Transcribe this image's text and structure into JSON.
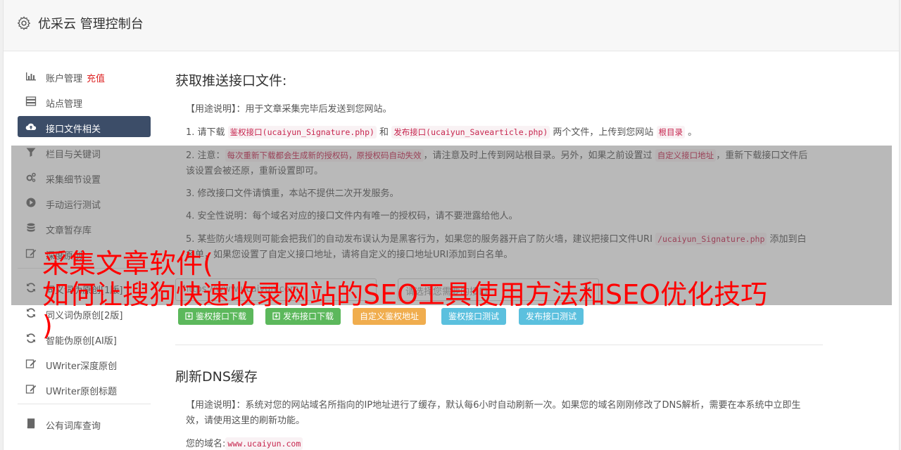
{
  "header": {
    "title": "优采云 管理控制台"
  },
  "sidebar": {
    "items": [
      {
        "label": "账户管理",
        "sub": "充值",
        "icon": "bar-chart-icon"
      },
      {
        "label": "站点管理",
        "icon": "server-icon"
      },
      {
        "label": "接口文件相关",
        "icon": "cloud-upload-icon",
        "active": true
      },
      {
        "label": "栏目与关键词",
        "icon": "filter-icon"
      },
      {
        "label": "采集细节设置",
        "icon": "cogs-icon"
      },
      {
        "label": "手动运行测试",
        "icon": "play-circle-icon"
      },
      {
        "label": "文章暂存库",
        "icon": "database-icon"
      },
      {
        "label": "深度原创",
        "icon": "edit-icon"
      }
    ],
    "items2": [
      {
        "label": "同义词伪原创[1版]",
        "icon": "refresh-icon"
      },
      {
        "label": "同义词伪原创[2版]",
        "icon": "refresh-icon"
      },
      {
        "label": "智能伪原创[AI版]",
        "icon": "refresh-icon"
      },
      {
        "label": "UWriter深度原创",
        "icon": "edit-icon"
      },
      {
        "label": "UWriter原创标题",
        "icon": "edit-icon"
      }
    ],
    "items3": [
      {
        "label": "公有词库查询",
        "icon": "book-icon"
      }
    ]
  },
  "section1": {
    "title": "获取推送接口文件:",
    "usage_label": "【用途说明】",
    "usage_text": "：用于文章采集完毕后发送到您网站。",
    "p1_a": "1. 请下载 ",
    "p1_code1": "鉴权接口(ucaiyun_Signature.php)",
    "p1_b": " 和 ",
    "p1_code2": "发布接口(ucaiyun_Savearticle.php)",
    "p1_c": " 两个文件，上传到您网站 ",
    "p1_code3": "根目录",
    "p1_d": " 。",
    "p2_a": "2. 注意：",
    "p2_code1": "每次重新下载都会生成新的授权码，原授权码自动失效",
    "p2_b": "，请注意及时上传到网站根目录。另外，如果之前设置过 ",
    "p2_code2": "自定义接口地址",
    "p2_c": "，重新下载接口文件后该设置会被还原，重新设置即可。",
    "p3": "3. 修改接口文件请慎重，本站不提供二次开发服务。",
    "p4": "4. 安全性说明：每个域名对应的接口文件内有唯一的授权码，请不要泄露给他人。",
    "p5_a": "5. 某些防火墙规则可能会把我们的自动发布误认为是黑客行为，如果您的服务器开启了防火墙，建议把接口文件URI ",
    "p5_code": "/ucaiyun_Signature.php",
    "p5_b": " 添加到白名单，如果您设置了自定义接口地址，请将自定义的接口地址URI添加到白名单。",
    "url_placeholder": "https://www.ucaiyun.com",
    "select_placeholder": "请选择您需要的接口",
    "buttons": {
      "sig_download": "鉴权接口下载",
      "pub_download": "发布接口下载",
      "custom_addr": "自定义鉴权地址",
      "sig_test": "鉴权接口测试",
      "pub_test": "发布接口测试"
    }
  },
  "section2": {
    "title": "刷新DNS缓存",
    "usage_label": "【用途说明】",
    "usage_text": "：系统对您的网站域名所指向的IP地址进行了缓存，默认每6小时自动刷新一次。如果您的域名刚刚修改了DNS解析，需要在本系统中立即生效，请使用这里的刷新功能。",
    "domain_label": "您的域名:",
    "domain_value": "www.ucaiyun.com"
  },
  "overlay": {
    "headline": "采集文章软件(\n如何让搜狗快速收录网站的SEO工具使用方法和SEO优化技巧\n)"
  },
  "colors": {
    "sidebar_active": "#3c4d68",
    "btn_green": "#5cb85c",
    "btn_orange": "#f0ad4e",
    "btn_blue": "#5bc0de",
    "headline_red": "#ff0000"
  }
}
